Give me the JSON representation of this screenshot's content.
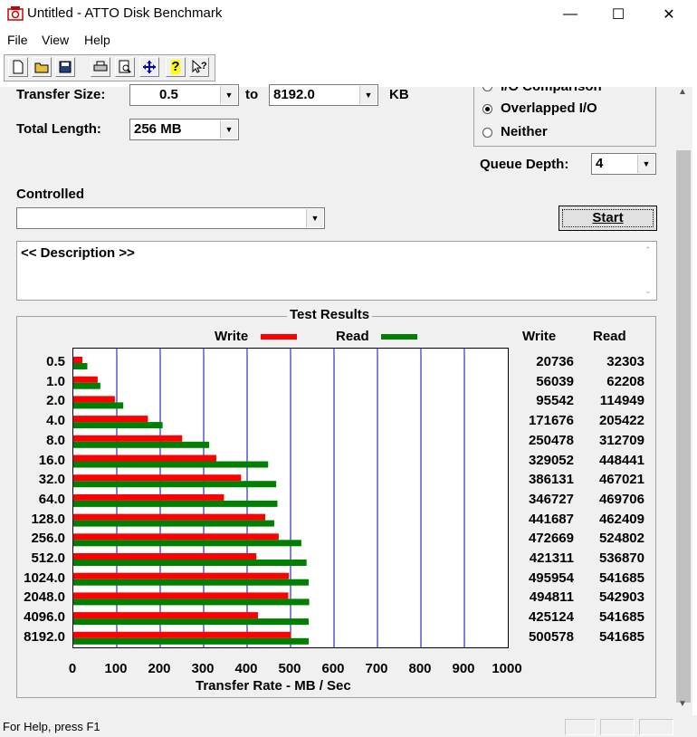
{
  "window": {
    "title": "Untitled - ATTO Disk Benchmark",
    "minimize": "—",
    "maximize": "☐",
    "close": "✕"
  },
  "menu": [
    "File",
    "View",
    "Help"
  ],
  "toolbar": [
    "new-file-icon",
    "open-folder-icon",
    "save-icon",
    "print-icon",
    "print-preview-icon",
    "move-icon",
    "help-icon",
    "context-help-icon"
  ],
  "settings": {
    "transfer_size_label": "Transfer Size:",
    "transfer_from": "0.5",
    "to_label": "to",
    "transfer_to": "8192.0",
    "kb_label": "KB",
    "total_length_label": "Total Length:",
    "total_length": "256 MB",
    "io_comparison_label": "I/O Comparison",
    "overlapped_label": "Overlapped I/O",
    "neither_label": "Neither",
    "queue_depth_label": "Queue Depth:",
    "queue_depth": "4",
    "controlled_label": "Controlled",
    "controlled_value": "",
    "start_label": "Start",
    "description": "<< Description >>"
  },
  "results": {
    "title": "Test Results",
    "write_legend": "Write",
    "read_legend": "Read",
    "write_header": "Write",
    "read_header": "Read"
  },
  "chart_data": {
    "type": "bar",
    "orientation": "horizontal",
    "categories": [
      "0.5",
      "1.0",
      "2.0",
      "4.0",
      "8.0",
      "16.0",
      "32.0",
      "64.0",
      "128.0",
      "256.0",
      "512.0",
      "1024.0",
      "2048.0",
      "4096.0",
      "8192.0"
    ],
    "series": [
      {
        "name": "Write",
        "color": "#ff0000",
        "values": [
          20736,
          56039,
          95542,
          171676,
          250478,
          329052,
          386131,
          346727,
          441687,
          472669,
          421311,
          495954,
          494811,
          425124,
          500578
        ]
      },
      {
        "name": "Read",
        "color": "#008000",
        "values": [
          32303,
          62208,
          114949,
          205422,
          312709,
          448441,
          467021,
          469706,
          462409,
          524802,
          536870,
          541685,
          542903,
          541685,
          541685
        ]
      }
    ],
    "xlabel": "Transfer Rate - MB / Sec",
    "xticks": [
      "0",
      "100",
      "200",
      "300",
      "400",
      "500",
      "600",
      "700",
      "800",
      "900",
      "1000"
    ],
    "xlim": [
      0,
      1000
    ],
    "grid": true,
    "grid_color": "#0000c0"
  },
  "status": {
    "help_text": "For Help, press F1"
  }
}
